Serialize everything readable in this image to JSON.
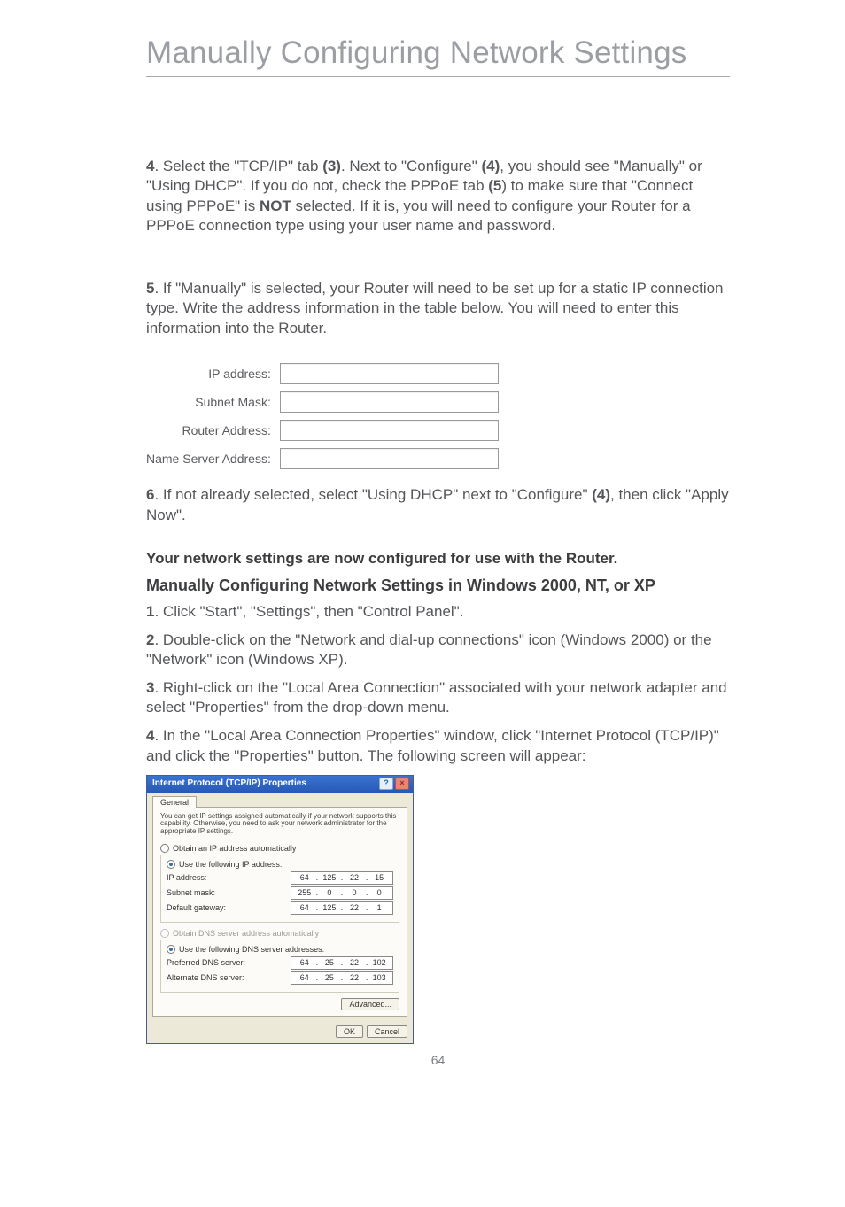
{
  "page": {
    "title": "Manually Configuring Network Settings",
    "number": "64"
  },
  "paragraphs": {
    "p4_num": "4",
    "p4_a": ". Select the \"TCP/IP\" tab ",
    "p4_ref3": "(3)",
    "p4_b": ". Next to \"Configure\" ",
    "p4_ref4": "(4)",
    "p4_c": ", you should see \"Manually\" or \"Using DHCP\". If you do not, check the PPPoE tab ",
    "p4_ref5": "(5",
    "p4_d": ") to make sure that \"Connect using PPPoE\" is ",
    "p4_not": "NOT",
    "p4_e": " selected. If it is, you will need to configure your Router for a PPPoE connection type using your user name and password.",
    "p5_num": "5",
    "p5": ". If \"Manually\" is selected, your Router will need to be set up for a static IP connection type. Write the address information in the table below. You will need to enter this information into the Router.",
    "p6_num": "6",
    "p6_a": ". If not already selected, select \"Using DHCP\" next to \"Configure\" ",
    "p6_ref4": "(4)",
    "p6_b": ", then click \"Apply Now\".",
    "confirm": "Your network settings are now configured for use with the Router.",
    "subheading": "Manually Configuring Network Settings in Windows 2000, NT, or XP",
    "w1_num": "1",
    "w1": ". Click \"Start\", \"Settings\", then \"Control Panel\".",
    "w2_num": "2",
    "w2": ". Double-click on the \"Network and dial-up connections\" icon (Windows 2000) or the \"Network\" icon (Windows XP).",
    "w3_num": "3",
    "w3": ". Right-click on the \"Local Area Connection\" associated with your network adapter and select \"Properties\" from the drop-down menu.",
    "w4_num": "4",
    "w4": ". In the \"Local Area Connection Properties\" window, click \"Internet Protocol (TCP/IP)\" and click the \"Properties\" button. The following screen will appear:"
  },
  "mac_table": {
    "ip": "IP address:",
    "subnet": "Subnet Mask:",
    "router": "Router Address:",
    "ns": "Name Server Address:"
  },
  "win": {
    "title": "Internet Protocol (TCP/IP) Properties",
    "help": "?",
    "close": "×",
    "tab": "General",
    "desc": "You can get IP settings assigned automatically if your network supports this capability. Otherwise, you need to ask your network administrator for the appropriate IP settings.",
    "radio_auto_ip": "Obtain an IP address automatically",
    "radio_use_ip": "Use the following IP address:",
    "lbl_ip": "IP address:",
    "lbl_sub": "Subnet mask:",
    "lbl_gw": "Default gateway:",
    "radio_auto_dns": "Obtain DNS server address automatically",
    "radio_use_dns": "Use the following DNS server addresses:",
    "lbl_pdns": "Preferred DNS server:",
    "lbl_adns": "Alternate DNS server:",
    "ip": [
      "64",
      "125",
      "22",
      "15"
    ],
    "sub": [
      "255",
      "0",
      "0",
      "0"
    ],
    "gw": [
      "64",
      "125",
      "22",
      "1"
    ],
    "pdns": [
      "64",
      "25",
      "22",
      "102"
    ],
    "adns": [
      "64",
      "25",
      "22",
      "103"
    ],
    "advanced": "Advanced...",
    "ok": "OK",
    "cancel": "Cancel"
  }
}
